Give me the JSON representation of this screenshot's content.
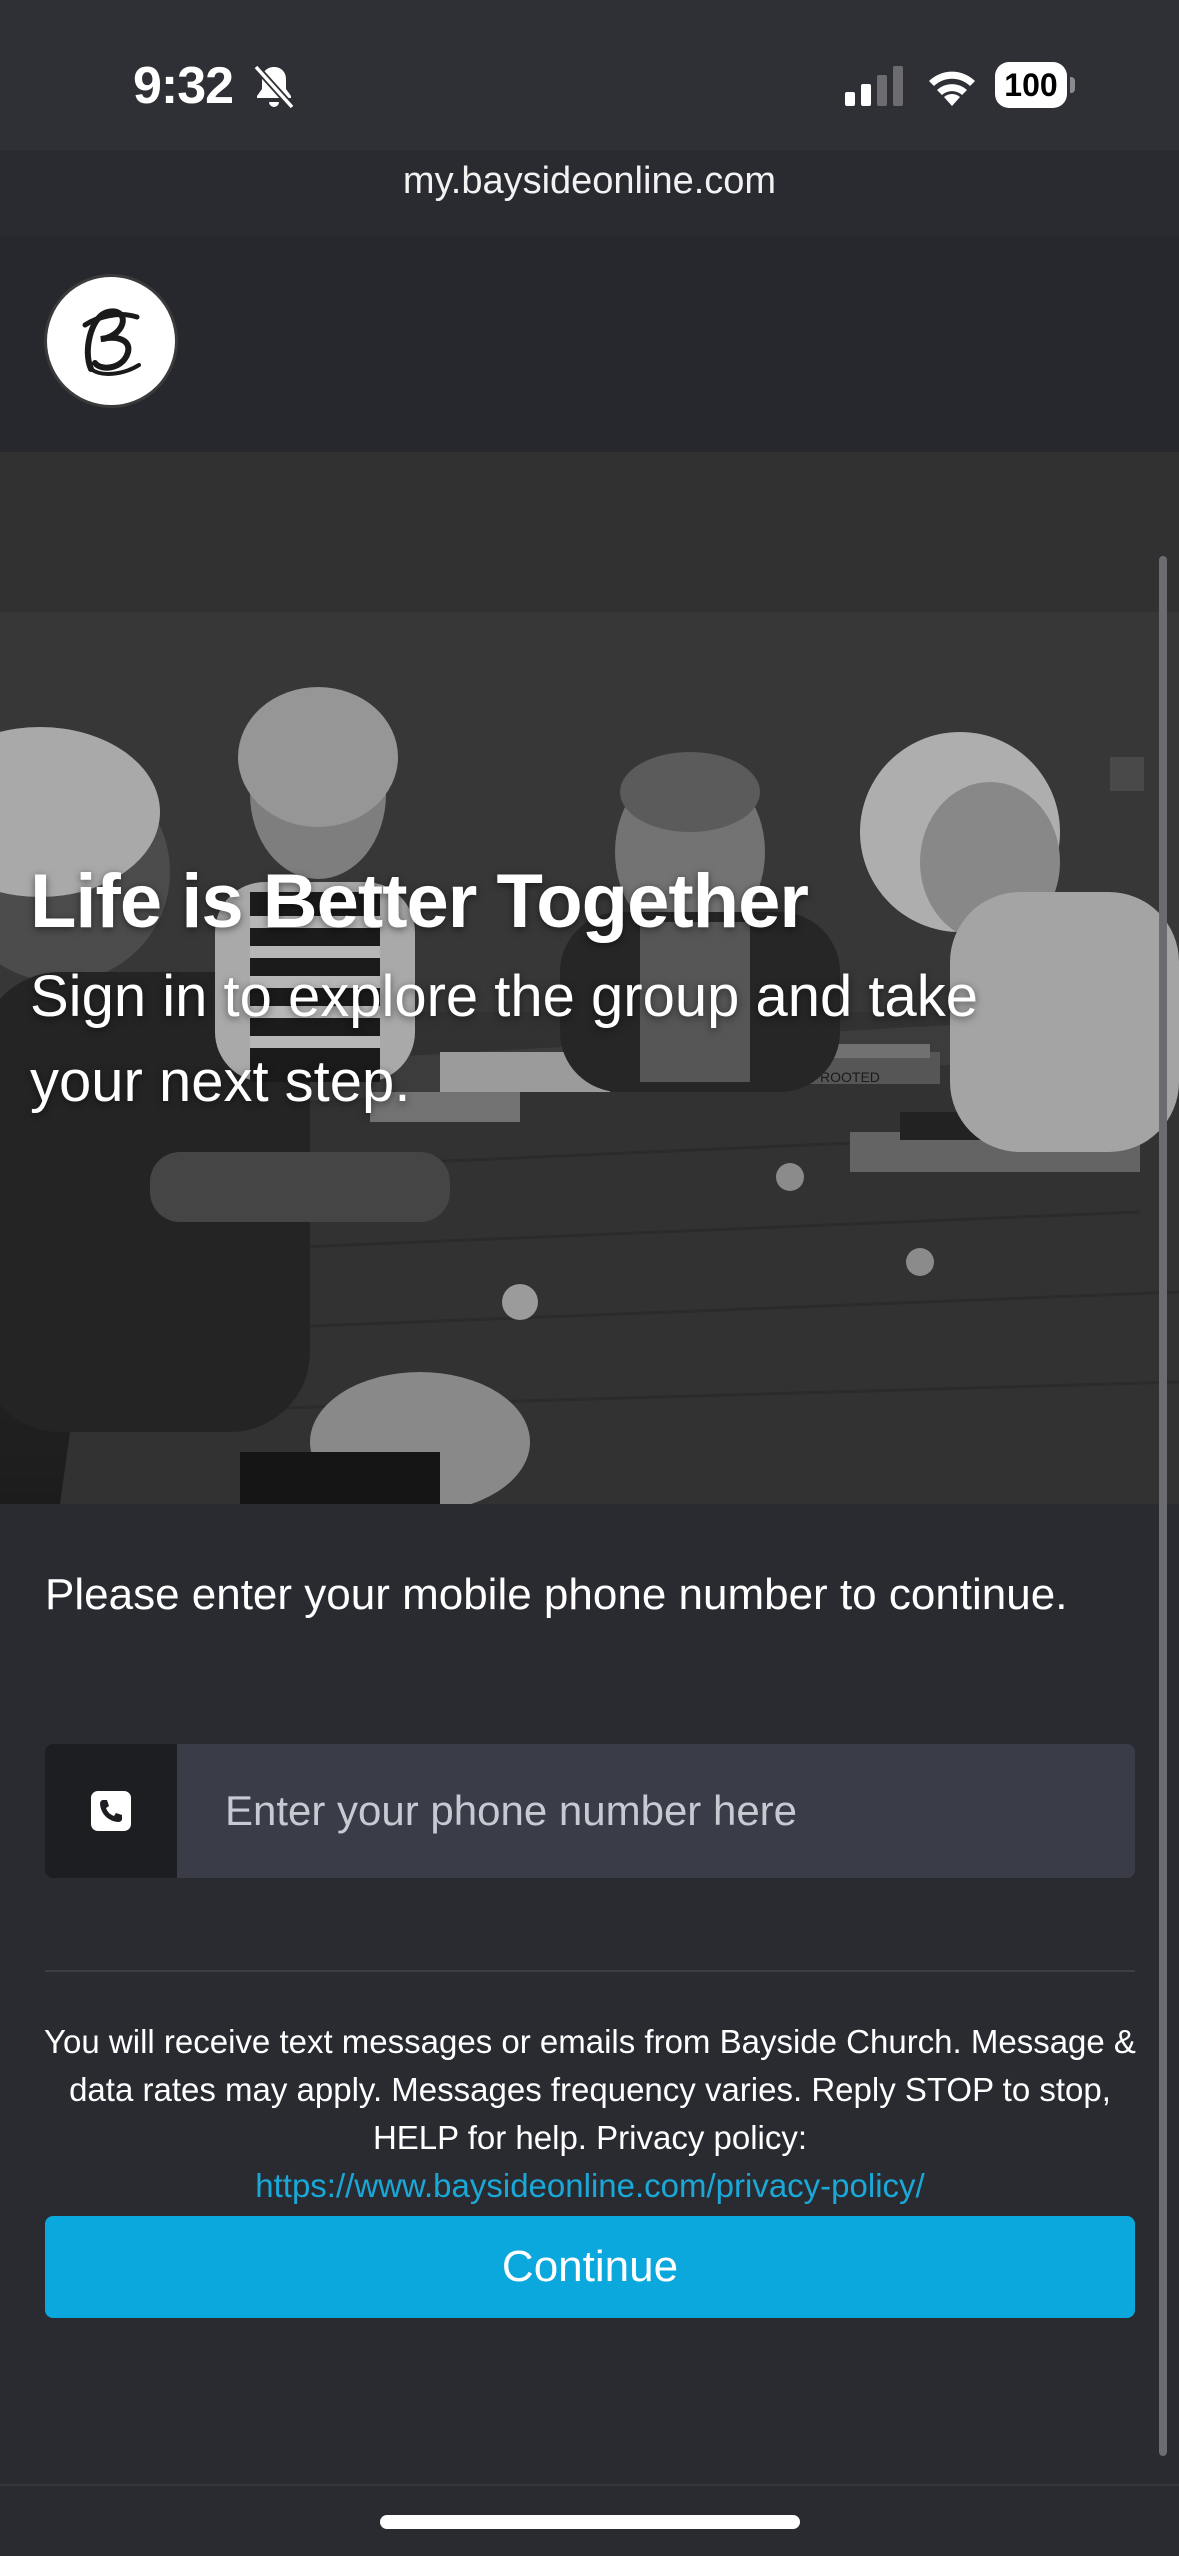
{
  "status_bar": {
    "time": "9:32",
    "battery": "100",
    "icons": [
      "bell-slash-icon",
      "cellular-signal-icon",
      "wifi-icon",
      "battery-icon"
    ]
  },
  "browser": {
    "url": "my.baysideonline.com"
  },
  "header": {
    "logo_letter": "B"
  },
  "hero": {
    "title": "Life is Better Together",
    "subtitle": "Sign in to explore the group and take your next step.",
    "photo_text": "ROOTED"
  },
  "form": {
    "prompt": "Please enter your mobile phone number to continue.",
    "phone_placeholder": "Enter your phone number here",
    "phone_value": "",
    "phone_icon": "phone-icon",
    "disclaimer": "You will receive text messages or emails from Bayside Church. Message & data rates may apply. Messages frequency varies. Reply STOP to stop, HELP for help. Privacy policy:",
    "privacy_link": "https://www.baysideonline.com/privacy-policy/",
    "continue_label": "Continue"
  },
  "colors": {
    "background": "#2a2b31",
    "header": "#27282d",
    "accent": "#0aa8dc",
    "link": "#1aa8d8",
    "input": "#3a3d47"
  }
}
